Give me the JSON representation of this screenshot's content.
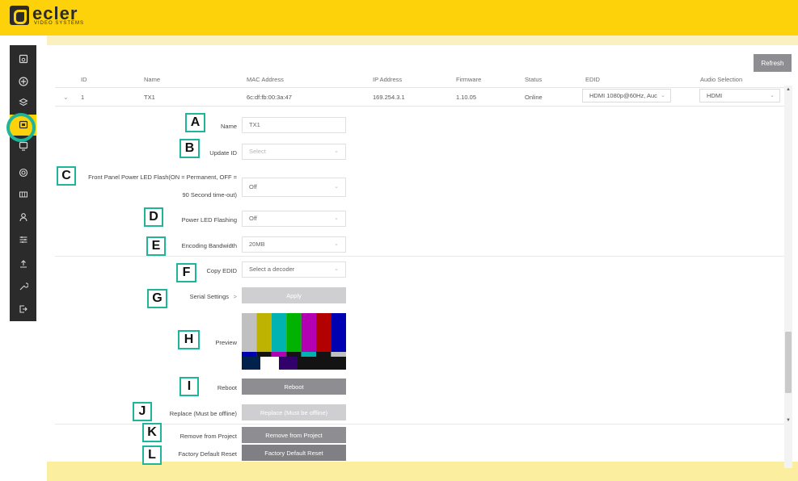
{
  "brand": {
    "name": "ecler",
    "sub": "VIDEO SYSTEMS",
    "accent": "#fdd20a",
    "highlight": "#1fb59a"
  },
  "toolbar": {
    "refresh_label": "Refresh"
  },
  "table": {
    "headers": [
      "ID",
      "Name",
      "MAC Address",
      "IP Address",
      "Firmware",
      "Status",
      "EDID",
      "Audio Selection"
    ],
    "row": {
      "id": "1",
      "name": "TX1",
      "mac": "6c:df:fb:00:3a:47",
      "ip": "169.254.3.1",
      "firmware": "1.10.05",
      "status": "Online",
      "edid": "HDMI 1080p@60Hz, Auc",
      "audio": "HDMI"
    }
  },
  "form": {
    "name_label": "Name",
    "name_value": "TX1",
    "update_id_label": "Update ID",
    "update_id_placeholder": "Select",
    "led_flash_label_1": "Front Panel Power LED Flash(ON = Permanent, OFF =",
    "led_flash_label_2": "90 Second time-out)",
    "led_flash_value": "Off",
    "power_led_label": "Power LED Flashing",
    "power_led_value": "Off",
    "bandwidth_label": "Encoding Bandwidth",
    "bandwidth_value": "20MB",
    "copy_edid_label": "Copy EDID",
    "copy_edid_value": "Select a decoder",
    "serial_label": "Serial Settings",
    "serial_chevron": ">",
    "apply_label": "Apply",
    "preview_label": "Preview",
    "reboot_label": "Reboot",
    "reboot_button": "Reboot",
    "replace_label": "Replace (Must be offline)",
    "replace_button": "Replace (Must be offline)",
    "remove_label": "Remove from Project",
    "remove_button": "Remove from Project",
    "factory_label": "Factory Default Reset",
    "factory_button": "Factory Default Reset"
  },
  "badges": [
    "A",
    "B",
    "C",
    "D",
    "E",
    "F",
    "G",
    "H",
    "I",
    "J",
    "K",
    "L"
  ],
  "sidebar_icons": [
    "screen-icon",
    "plus-circle-icon",
    "layers-icon",
    "encoder-icon",
    "decoder-icon",
    "wifi-icon",
    "grid-icon",
    "user-icon",
    "sliders-icon",
    "upload-icon",
    "wrench-icon",
    "logout-icon"
  ]
}
